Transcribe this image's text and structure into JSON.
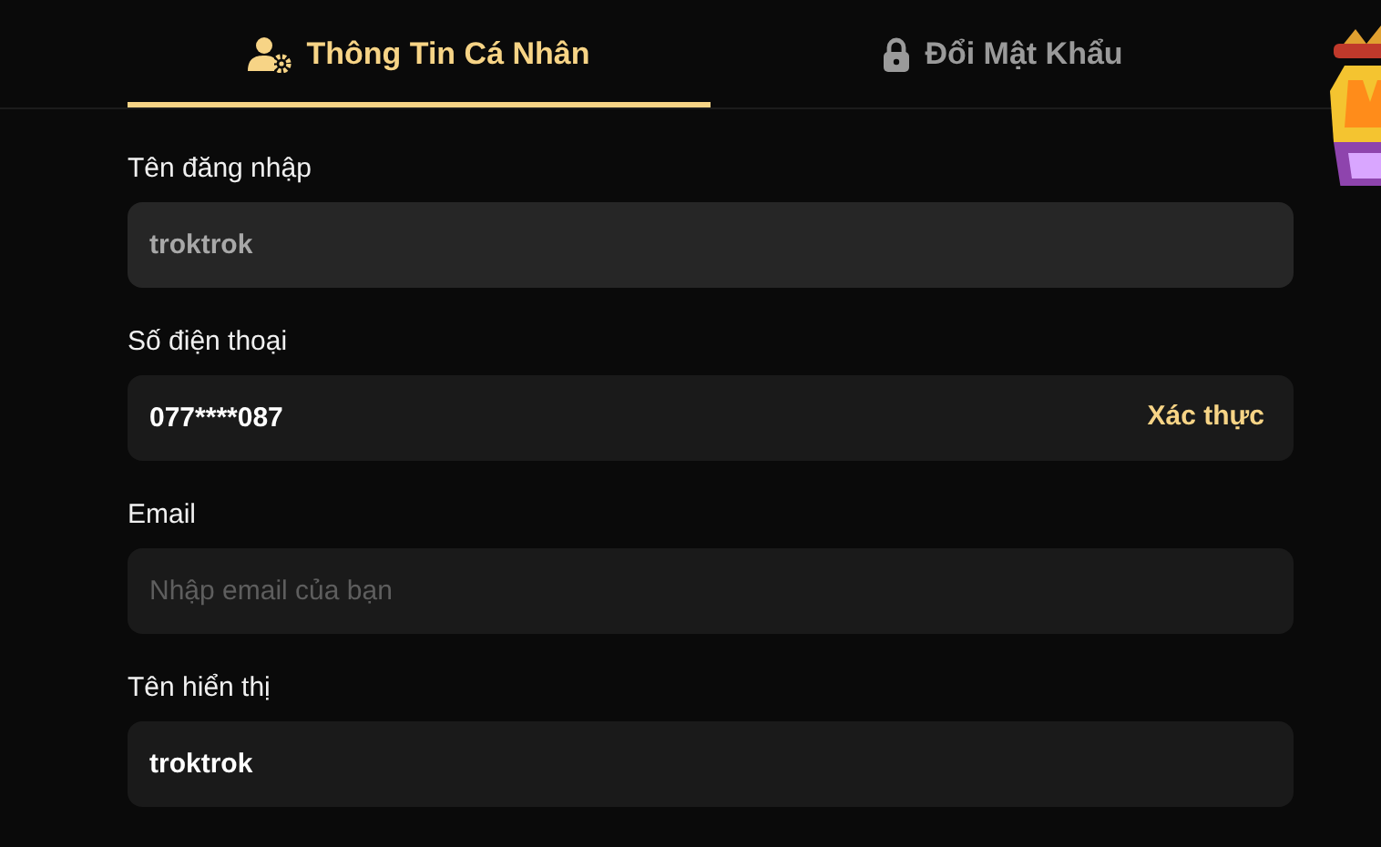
{
  "tabs": [
    {
      "label": "Thông Tin Cá Nhân",
      "selected": true
    },
    {
      "label": "Đổi Mật Khẩu",
      "selected": false
    }
  ],
  "fields": [
    {
      "label": "Tên đăng nhập",
      "value": "troktrok",
      "disabled": true
    },
    {
      "label": "Số điện thoại",
      "value": "077****087",
      "disabled": false,
      "action": "Xác thực"
    },
    {
      "label": "Email",
      "placeholder": "Nhập email của bạn",
      "disabled": false
    },
    {
      "label": "Tên hiển thị",
      "value": "troktrok",
      "disabled": false
    }
  ]
}
